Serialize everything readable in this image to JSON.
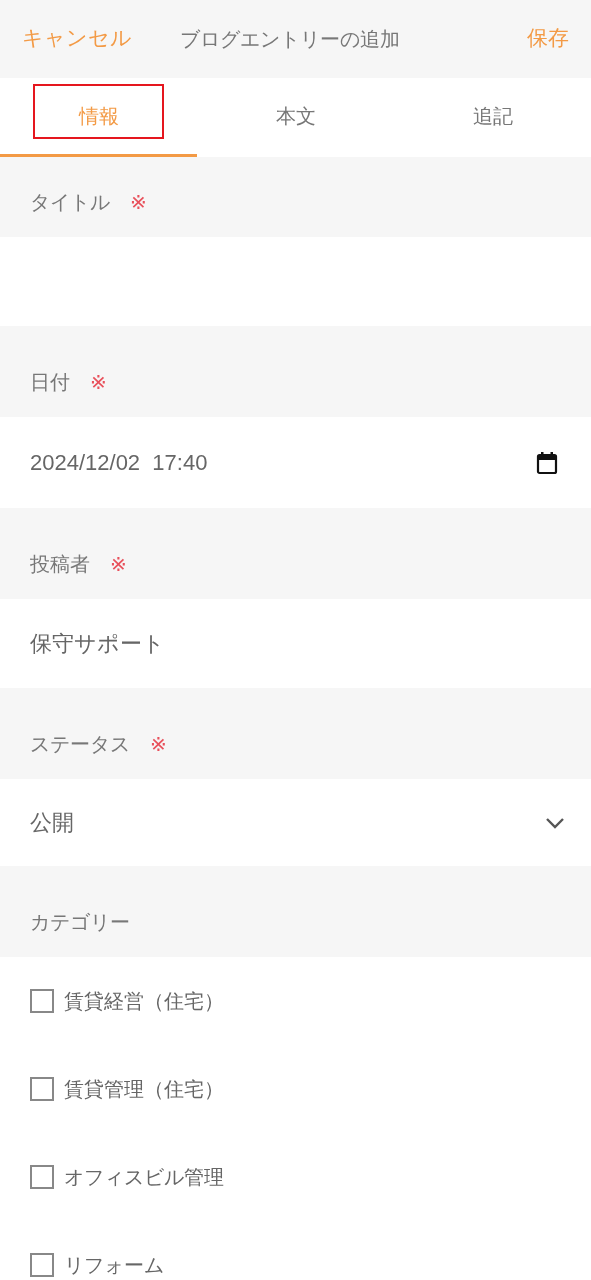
{
  "header": {
    "cancel": "キャンセル",
    "title": "ブログエントリーの追加",
    "save": "保存"
  },
  "tabs": [
    {
      "label": "情報",
      "selected": true,
      "highlighted": true
    },
    {
      "label": "本文",
      "selected": false,
      "highlighted": false
    },
    {
      "label": "追記",
      "selected": false,
      "highlighted": false
    }
  ],
  "fields": [
    {
      "kind": "text",
      "label": "タイトル",
      "required_mark": "※"
    },
    {
      "kind": "datetime",
      "label": "日付",
      "required_mark": "※",
      "value": "2024/12/02  17:40"
    },
    {
      "kind": "text",
      "label": "投稿者",
      "required_mark": "※",
      "value": "保守サポート"
    },
    {
      "kind": "select",
      "label": "ステータス",
      "required_mark": "※",
      "value": "公開"
    },
    {
      "kind": "checkboxes",
      "label": "カテゴリー",
      "options": [
        {
          "label": "賃貸経営（住宅）",
          "checked": false
        },
        {
          "label": "賃貸管理（住宅）",
          "checked": false
        },
        {
          "label": "オフィスビル管理",
          "checked": false
        },
        {
          "label": "リフォーム",
          "checked": false
        }
      ]
    }
  ]
}
